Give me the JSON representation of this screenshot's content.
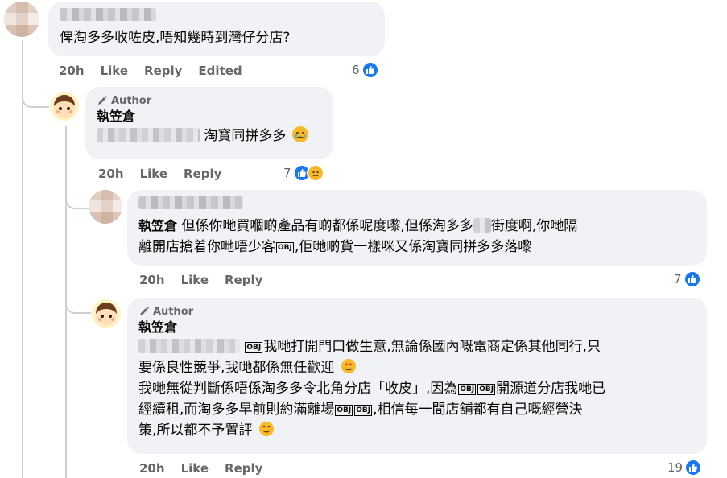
{
  "comment1": {
    "text": "俾淘多多收咗皮,唔知幾時到灣仔分店?",
    "box_glyph": "OBJ",
    "time": "20h",
    "like": "Like",
    "reply": "Reply",
    "edited": "Edited",
    "reaction_count": "6"
  },
  "reply1": {
    "author_badge": "Author",
    "name": "執笠倉",
    "text": "淘寶同拼多多",
    "time": "20h",
    "like": "Like",
    "reply": "Reply",
    "reaction_count": "7"
  },
  "comment2": {
    "mention": "執笠倉",
    "line1_a": "但係你哋買嗰啲產品有啲都係呢度嚟,但係淘多多",
    "line1_b": "街度啊,你哋隔",
    "line2_a": "離開店搶着你哋唔少客",
    "line2_b": ",佢哋啲貨一樣咪又係淘寶同拼多多落嚟",
    "box_glyph": "OBJ",
    "time": "20h",
    "like": "Like",
    "reply": "Reply",
    "reaction_count": "7"
  },
  "reply2": {
    "author_badge": "Author",
    "name": "執笠倉",
    "line1": "我哋打開門口做生意,無論係國內嘅電商定係其他同行,只",
    "line2": "要係良性競爭,我哋都係無任歡迎",
    "line3_a": "我哋無從判斷係唔係淘多多令北角分店「收皮」,因為",
    "line3_b": "開源道分店我哋已",
    "line4_a": "經續租,而淘多多早前則約滿離場",
    "line4_b": ",相信每一間店舖都有自己嘅經營決",
    "line5": "策,所以都不予置評",
    "box_glyph": "OBJ",
    "time": "20h",
    "like": "Like",
    "reply": "Reply",
    "reaction_count": "19"
  },
  "colors": {
    "bubble": "#f0f2f5",
    "like_blue": "#1877f2",
    "meta_gray": "#65676b"
  },
  "icons": [
    "like-icon",
    "sad-icon",
    "pencil-icon",
    "smile-icon",
    "crying-icon",
    "heart-eyes-icon"
  ]
}
